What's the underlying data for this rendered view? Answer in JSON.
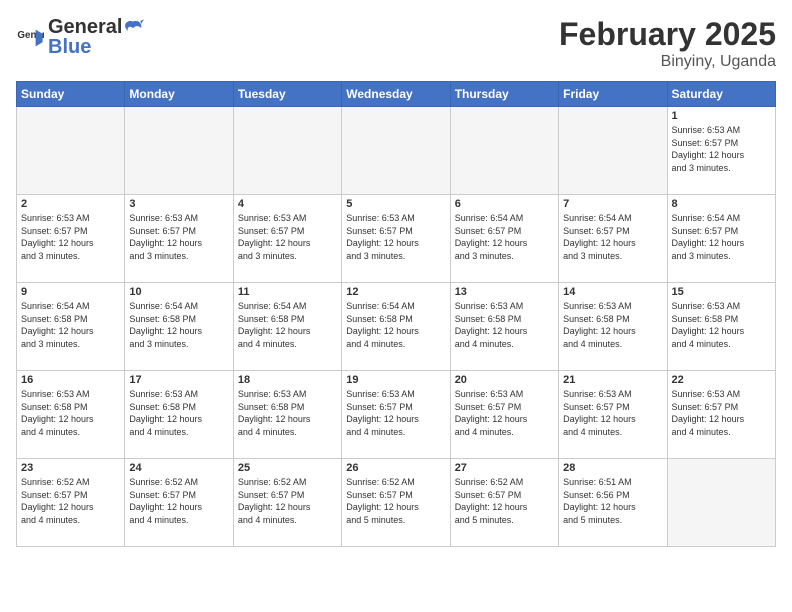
{
  "header": {
    "logo_general": "General",
    "logo_blue": "Blue",
    "month_title": "February 2025",
    "location": "Binyiny, Uganda"
  },
  "weekdays": [
    "Sunday",
    "Monday",
    "Tuesday",
    "Wednesday",
    "Thursday",
    "Friday",
    "Saturday"
  ],
  "weeks": [
    [
      {
        "day": "",
        "info": ""
      },
      {
        "day": "",
        "info": ""
      },
      {
        "day": "",
        "info": ""
      },
      {
        "day": "",
        "info": ""
      },
      {
        "day": "",
        "info": ""
      },
      {
        "day": "",
        "info": ""
      },
      {
        "day": "1",
        "info": "Sunrise: 6:53 AM\nSunset: 6:57 PM\nDaylight: 12 hours\nand 3 minutes."
      }
    ],
    [
      {
        "day": "2",
        "info": "Sunrise: 6:53 AM\nSunset: 6:57 PM\nDaylight: 12 hours\nand 3 minutes."
      },
      {
        "day": "3",
        "info": "Sunrise: 6:53 AM\nSunset: 6:57 PM\nDaylight: 12 hours\nand 3 minutes."
      },
      {
        "day": "4",
        "info": "Sunrise: 6:53 AM\nSunset: 6:57 PM\nDaylight: 12 hours\nand 3 minutes."
      },
      {
        "day": "5",
        "info": "Sunrise: 6:53 AM\nSunset: 6:57 PM\nDaylight: 12 hours\nand 3 minutes."
      },
      {
        "day": "6",
        "info": "Sunrise: 6:54 AM\nSunset: 6:57 PM\nDaylight: 12 hours\nand 3 minutes."
      },
      {
        "day": "7",
        "info": "Sunrise: 6:54 AM\nSunset: 6:57 PM\nDaylight: 12 hours\nand 3 minutes."
      },
      {
        "day": "8",
        "info": "Sunrise: 6:54 AM\nSunset: 6:57 PM\nDaylight: 12 hours\nand 3 minutes."
      }
    ],
    [
      {
        "day": "9",
        "info": "Sunrise: 6:54 AM\nSunset: 6:58 PM\nDaylight: 12 hours\nand 3 minutes."
      },
      {
        "day": "10",
        "info": "Sunrise: 6:54 AM\nSunset: 6:58 PM\nDaylight: 12 hours\nand 3 minutes."
      },
      {
        "day": "11",
        "info": "Sunrise: 6:54 AM\nSunset: 6:58 PM\nDaylight: 12 hours\nand 4 minutes."
      },
      {
        "day": "12",
        "info": "Sunrise: 6:54 AM\nSunset: 6:58 PM\nDaylight: 12 hours\nand 4 minutes."
      },
      {
        "day": "13",
        "info": "Sunrise: 6:53 AM\nSunset: 6:58 PM\nDaylight: 12 hours\nand 4 minutes."
      },
      {
        "day": "14",
        "info": "Sunrise: 6:53 AM\nSunset: 6:58 PM\nDaylight: 12 hours\nand 4 minutes."
      },
      {
        "day": "15",
        "info": "Sunrise: 6:53 AM\nSunset: 6:58 PM\nDaylight: 12 hours\nand 4 minutes."
      }
    ],
    [
      {
        "day": "16",
        "info": "Sunrise: 6:53 AM\nSunset: 6:58 PM\nDaylight: 12 hours\nand 4 minutes."
      },
      {
        "day": "17",
        "info": "Sunrise: 6:53 AM\nSunset: 6:58 PM\nDaylight: 12 hours\nand 4 minutes."
      },
      {
        "day": "18",
        "info": "Sunrise: 6:53 AM\nSunset: 6:58 PM\nDaylight: 12 hours\nand 4 minutes."
      },
      {
        "day": "19",
        "info": "Sunrise: 6:53 AM\nSunset: 6:57 PM\nDaylight: 12 hours\nand 4 minutes."
      },
      {
        "day": "20",
        "info": "Sunrise: 6:53 AM\nSunset: 6:57 PM\nDaylight: 12 hours\nand 4 minutes."
      },
      {
        "day": "21",
        "info": "Sunrise: 6:53 AM\nSunset: 6:57 PM\nDaylight: 12 hours\nand 4 minutes."
      },
      {
        "day": "22",
        "info": "Sunrise: 6:53 AM\nSunset: 6:57 PM\nDaylight: 12 hours\nand 4 minutes."
      }
    ],
    [
      {
        "day": "23",
        "info": "Sunrise: 6:52 AM\nSunset: 6:57 PM\nDaylight: 12 hours\nand 4 minutes."
      },
      {
        "day": "24",
        "info": "Sunrise: 6:52 AM\nSunset: 6:57 PM\nDaylight: 12 hours\nand 4 minutes."
      },
      {
        "day": "25",
        "info": "Sunrise: 6:52 AM\nSunset: 6:57 PM\nDaylight: 12 hours\nand 4 minutes."
      },
      {
        "day": "26",
        "info": "Sunrise: 6:52 AM\nSunset: 6:57 PM\nDaylight: 12 hours\nand 5 minutes."
      },
      {
        "day": "27",
        "info": "Sunrise: 6:52 AM\nSunset: 6:57 PM\nDaylight: 12 hours\nand 5 minutes."
      },
      {
        "day": "28",
        "info": "Sunrise: 6:51 AM\nSunset: 6:56 PM\nDaylight: 12 hours\nand 5 minutes."
      },
      {
        "day": "",
        "info": ""
      }
    ]
  ]
}
